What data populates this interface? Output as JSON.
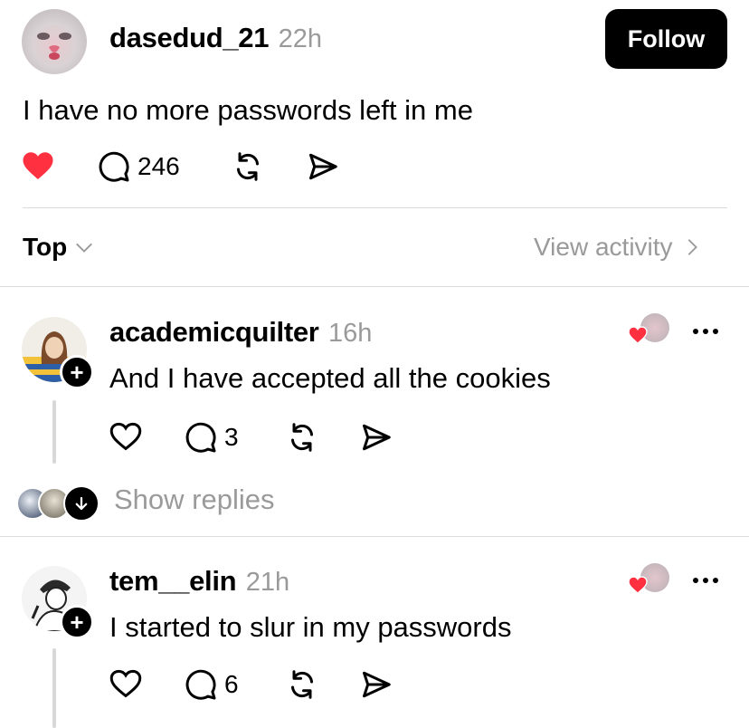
{
  "post": {
    "username": "dasedud_21",
    "time": "22h",
    "follow_label": "Follow",
    "text": "I have no more passwords left in me",
    "reply_count": "246",
    "liked": true
  },
  "sort": {
    "label": "Top",
    "view_activity_label": "View activity"
  },
  "replies": [
    {
      "username": "academicquilter",
      "time": "16h",
      "text": "And I have accepted all the cookies",
      "reply_count": "3",
      "show_replies_label": "Show replies"
    },
    {
      "username": "tem__elin",
      "time": "21h",
      "text": "I started to slur in my passwords",
      "reply_count": "6"
    }
  ],
  "colors": {
    "like_red": "#ff3040",
    "secondary_text": "#9a9a9a",
    "follow_bg": "#000000"
  },
  "icons": [
    "heart-icon",
    "comment-icon",
    "repost-icon",
    "share-icon",
    "chevron-down-icon",
    "chevron-right-icon",
    "more-icon",
    "plus-icon",
    "arrow-down-icon"
  ]
}
